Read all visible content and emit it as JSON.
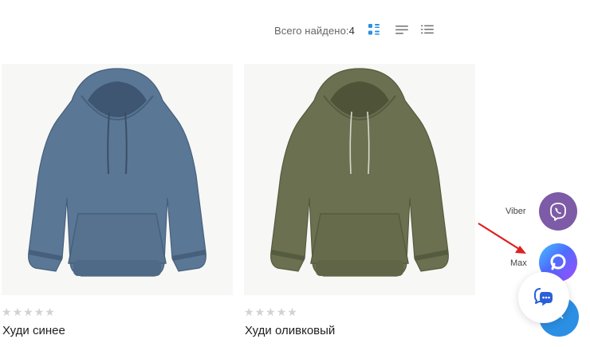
{
  "toolbar": {
    "found_label": "Всего найдено:",
    "found_count": "4",
    "views": [
      {
        "icon": "grid-view-icon",
        "active": true
      },
      {
        "icon": "list-view-icon",
        "active": false
      },
      {
        "icon": "compact-list-view-icon",
        "active": false
      }
    ]
  },
  "products": [
    {
      "title": "Худи синее",
      "rating": 0,
      "max_rating": 5,
      "color": "#5b7796",
      "image_icon": "blue-hoodie-image"
    },
    {
      "title": "Худи оливковый",
      "rating": 0,
      "max_rating": 5,
      "color": "#6b7150",
      "image_icon": "olive-hoodie-image"
    }
  ],
  "contacts": {
    "viber_label": "Viber",
    "max_label": "Max",
    "viber_color": "#7d5ba6",
    "accent_color": "#2b8fe3"
  }
}
